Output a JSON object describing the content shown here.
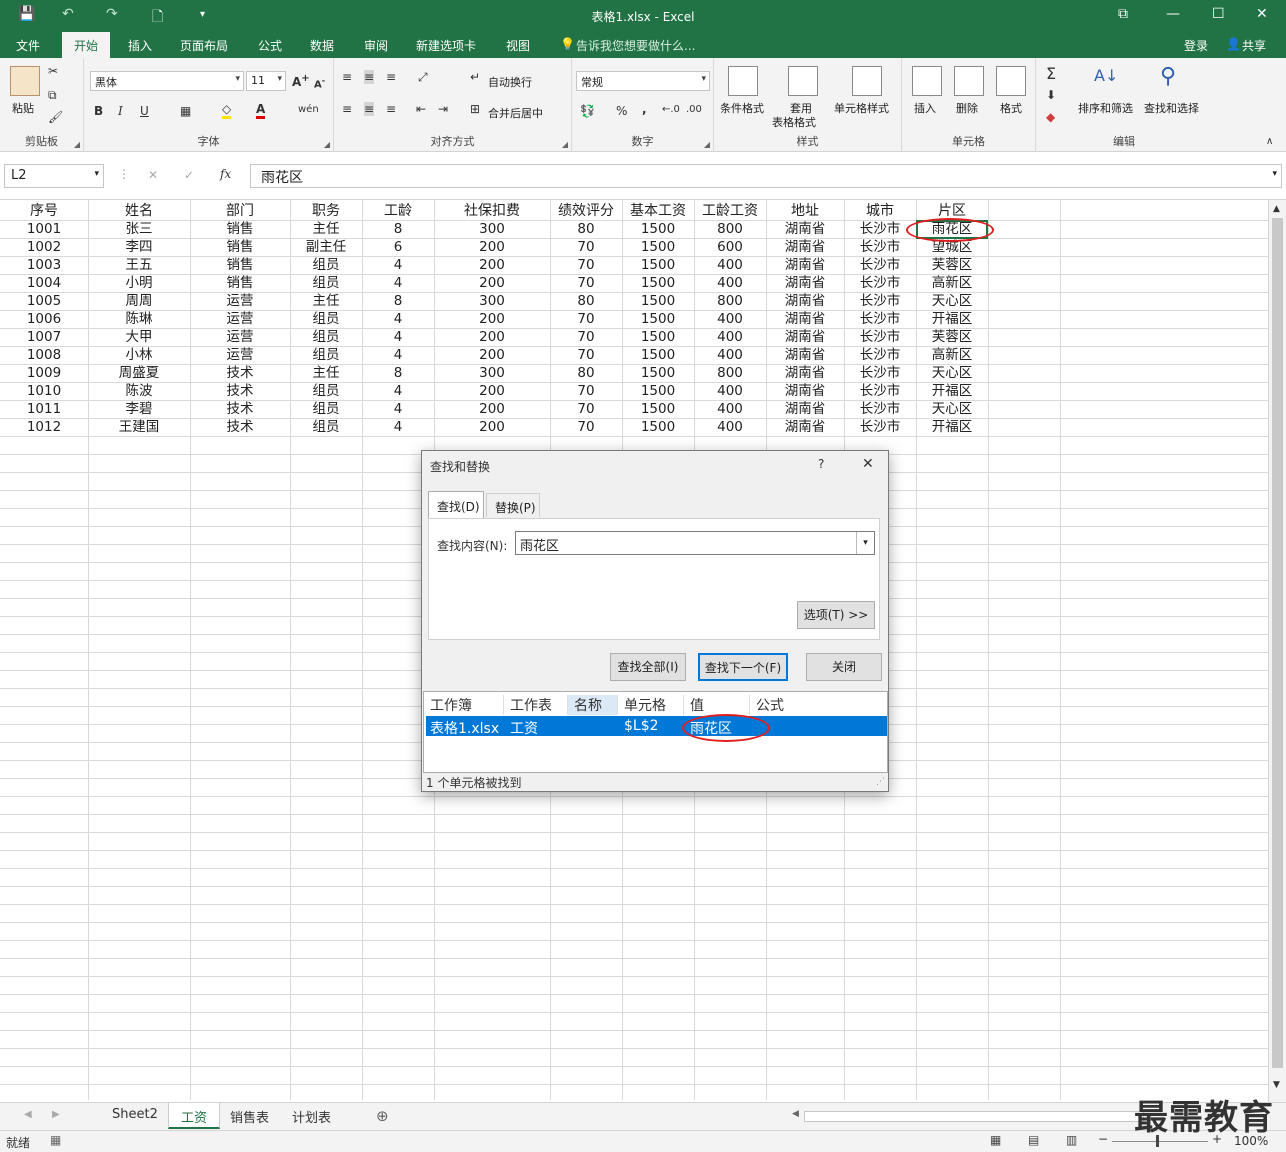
{
  "window": {
    "title": "表格1.xlsx - Excel"
  },
  "menu": {
    "tabs": [
      "文件",
      "开始",
      "插入",
      "页面布局",
      "公式",
      "数据",
      "审阅",
      "新建选项卡",
      "视图"
    ],
    "tell_me": "告诉我您想要做什么...",
    "login": "登录",
    "share": "共享"
  },
  "ribbon": {
    "clipboard": {
      "paste": "粘贴",
      "label": "剪贴板"
    },
    "font": {
      "name": "黑体",
      "size": "11",
      "label": "字体",
      "bold": "B",
      "italic": "I",
      "underline": "U"
    },
    "align": {
      "wrap": "自动换行",
      "merge": "合并后居中",
      "label": "对齐方式"
    },
    "number": {
      "format": "常规",
      "percent": "%",
      "comma": ",",
      "label": "数字"
    },
    "styles": {
      "cond": "条件格式",
      "table_l1": "套用",
      "table_l2": "表格格式",
      "cell": "单元格样式",
      "label": "样式"
    },
    "cells": {
      "insert": "插入",
      "delete": "删除",
      "format": "格式",
      "label": "单元格"
    },
    "editing": {
      "sort": "排序和筛选",
      "find": "查找和选择",
      "label": "编辑"
    }
  },
  "formula_bar": {
    "name_box": "L2",
    "value": "雨花区"
  },
  "sheet": {
    "headers": [
      "序号",
      "姓名",
      "部门",
      "职务",
      "工龄",
      "社保扣费",
      "绩效评分",
      "基本工资",
      "工龄工资",
      "地址",
      "城市",
      "片区"
    ],
    "rows": [
      [
        "1001",
        "张三",
        "销售",
        "主任",
        "8",
        "300",
        "80",
        "1500",
        "800",
        "湖南省",
        "长沙市",
        "雨花区"
      ],
      [
        "1002",
        "李四",
        "销售",
        "副主任",
        "6",
        "200",
        "70",
        "1500",
        "600",
        "湖南省",
        "长沙市",
        "望城区"
      ],
      [
        "1003",
        "王五",
        "销售",
        "组员",
        "4",
        "200",
        "70",
        "1500",
        "400",
        "湖南省",
        "长沙市",
        "芙蓉区"
      ],
      [
        "1004",
        "小明",
        "销售",
        "组员",
        "4",
        "200",
        "70",
        "1500",
        "400",
        "湖南省",
        "长沙市",
        "高新区"
      ],
      [
        "1005",
        "周周",
        "运营",
        "主任",
        "8",
        "300",
        "80",
        "1500",
        "800",
        "湖南省",
        "长沙市",
        "天心区"
      ],
      [
        "1006",
        "陈琳",
        "运营",
        "组员",
        "4",
        "200",
        "70",
        "1500",
        "400",
        "湖南省",
        "长沙市",
        "开福区"
      ],
      [
        "1007",
        "大甲",
        "运营",
        "组员",
        "4",
        "200",
        "70",
        "1500",
        "400",
        "湖南省",
        "长沙市",
        "芙蓉区"
      ],
      [
        "1008",
        "小林",
        "运营",
        "组员",
        "4",
        "200",
        "70",
        "1500",
        "400",
        "湖南省",
        "长沙市",
        "高新区"
      ],
      [
        "1009",
        "周盛夏",
        "技术",
        "主任",
        "8",
        "300",
        "80",
        "1500",
        "800",
        "湖南省",
        "长沙市",
        "天心区"
      ],
      [
        "1010",
        "陈波",
        "技术",
        "组员",
        "4",
        "200",
        "70",
        "1500",
        "400",
        "湖南省",
        "长沙市",
        "开福区"
      ],
      [
        "1011",
        "李碧",
        "技术",
        "组员",
        "4",
        "200",
        "70",
        "1500",
        "400",
        "湖南省",
        "长沙市",
        "天心区"
      ],
      [
        "1012",
        "王建国",
        "技术",
        "组员",
        "4",
        "200",
        "70",
        "1500",
        "400",
        "湖南省",
        "长沙市",
        "开福区"
      ]
    ]
  },
  "dialog": {
    "title": "查找和替换",
    "help": "?",
    "close": "✕",
    "tab_find": "查找(D)",
    "tab_replace": "替换(P)",
    "find_label": "查找内容(N):",
    "find_value": "雨花区",
    "options": "选项(T) >>",
    "find_all": "查找全部(I)",
    "find_next": "查找下一个(F)",
    "close_btn": "关闭",
    "result_headers": [
      "工作簿",
      "工作表",
      "名称",
      "单元格",
      "值",
      "公式"
    ],
    "result_row": [
      "表格1.xlsx",
      "工资",
      "",
      "$L$2",
      "雨花区",
      ""
    ],
    "status": "1 个单元格被找到"
  },
  "sheet_tabs": [
    "Sheet2",
    "工资",
    "销售表",
    "计划表"
  ],
  "status": {
    "ready": "就绪",
    "zoom": "100%"
  },
  "watermark": "最需教育",
  "colors": {
    "accent": "#217346",
    "selection": "#0078d7",
    "highlight": "#e02020"
  }
}
